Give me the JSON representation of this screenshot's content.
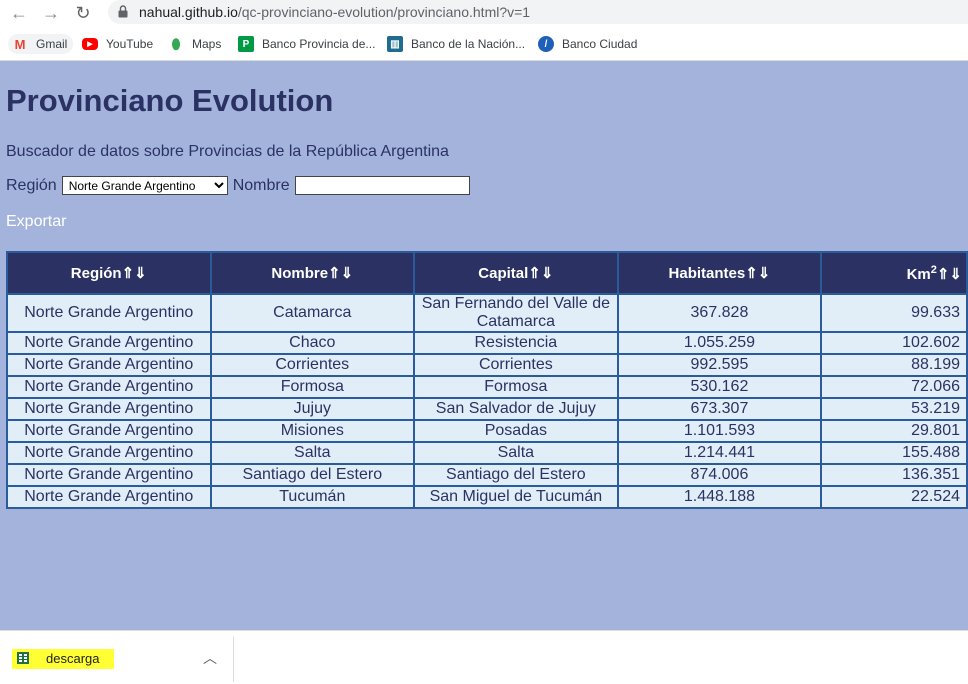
{
  "browser": {
    "url_host": "nahual.github.io",
    "url_path": "/qc-provinciano-evolution/provinciano.html?v=1",
    "bookmarks": [
      {
        "label": "Gmail",
        "icon": "gmail-icon",
        "color": "#ea4335"
      },
      {
        "label": "YouTube",
        "icon": "youtube-icon",
        "color": "#ff0000"
      },
      {
        "label": "Maps",
        "icon": "maps-icon",
        "color": "#34a853"
      },
      {
        "label": "Banco Provincia de...",
        "icon": "banco-provincia-icon",
        "color": "#009a44"
      },
      {
        "label": "Banco de la Nación...",
        "icon": "banco-nacion-icon",
        "color": "#1f6c8f"
      },
      {
        "label": "Banco Ciudad",
        "icon": "banco-ciudad-icon",
        "color": "#1e60b8"
      }
    ]
  },
  "page": {
    "title": "Provinciano Evolution",
    "subtitle": "Buscador de datos sobre Provincias de la República Argentina",
    "region_label": "Región",
    "region_selected": "Norte Grande Argentino",
    "name_label": "Nombre",
    "name_value": "",
    "export_label": "Exportar"
  },
  "table": {
    "headers": [
      "Región⇑⇓",
      "Nombre⇑⇓",
      "Capital⇑⇓",
      "Habitantes⇑⇓",
      "Km",
      "⇑⇓"
    ],
    "km_sup": "2",
    "rows": [
      [
        "Norte Grande Argentino",
        "Catamarca",
        "San Fernando del Valle de Catamarca",
        "367.828",
        "99.633"
      ],
      [
        "Norte Grande Argentino",
        "Chaco",
        "Resistencia",
        "1.055.259",
        "102.602"
      ],
      [
        "Norte Grande Argentino",
        "Corrientes",
        "Corrientes",
        "992.595",
        "88.199"
      ],
      [
        "Norte Grande Argentino",
        "Formosa",
        "Formosa",
        "530.162",
        "72.066"
      ],
      [
        "Norte Grande Argentino",
        "Jujuy",
        "San Salvador de Jujuy",
        "673.307",
        "53.219"
      ],
      [
        "Norte Grande Argentino",
        "Misiones",
        "Posadas",
        "1.101.593",
        "29.801"
      ],
      [
        "Norte Grande Argentino",
        "Salta",
        "Salta",
        "1.214.441",
        "155.488"
      ],
      [
        "Norte Grande Argentino",
        "Santiago del Estero",
        "Santiago del Estero",
        "874.006",
        "136.351"
      ],
      [
        "Norte Grande Argentino",
        "Tucumán",
        "San Miguel de Tucumán",
        "1.448.188",
        "22.524"
      ]
    ]
  },
  "download": {
    "filename": "descarga"
  }
}
